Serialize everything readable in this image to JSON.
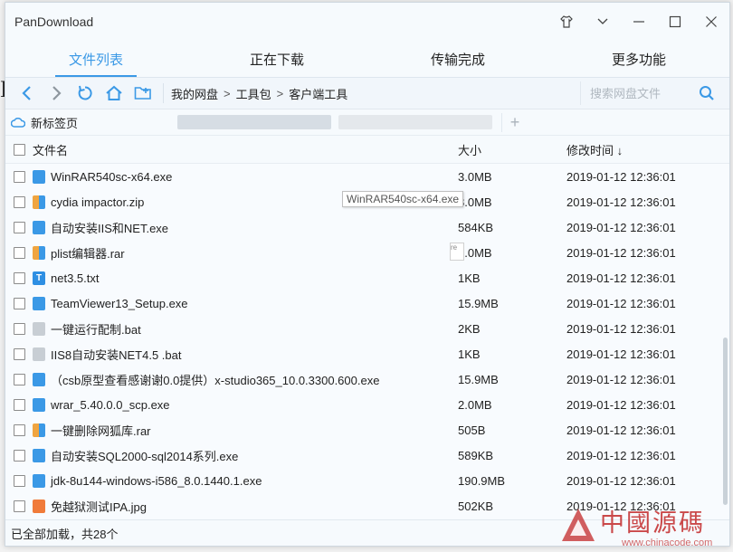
{
  "background_fragment": "I",
  "window": {
    "title": "PanDownload",
    "controls": [
      "shirt-icon",
      "chevron-down-icon",
      "minimize-icon",
      "maximize-icon",
      "close-icon"
    ]
  },
  "tabs": [
    {
      "label": "文件列表",
      "active": true
    },
    {
      "label": "正在下载",
      "active": false
    },
    {
      "label": "传输完成",
      "active": false
    },
    {
      "label": "更多功能",
      "active": false
    }
  ],
  "breadcrumb": [
    "我的网盘",
    "工具包",
    "客户端工具"
  ],
  "breadcrumb_sep": ">",
  "search": {
    "placeholder": "搜索网盘文件"
  },
  "browser_tab": {
    "label": "新标签页"
  },
  "columns": {
    "name": "文件名",
    "size": "大小",
    "date": "修改时间 ↓"
  },
  "files": [
    {
      "name": "WinRAR540sc-x64.exe",
      "size": "3.0MB",
      "date": "2019-01-12 12:36:01",
      "type": "exe"
    },
    {
      "name": "cydia impactor.zip",
      "size": "8.0MB",
      "date": "2019-01-12 12:36:01",
      "type": "zip"
    },
    {
      "name": "自动安装IIS和NET.exe",
      "size": "584KB",
      "date": "2019-01-12 12:36:01",
      "type": "exe"
    },
    {
      "name": "plist编辑器.rar",
      "size": "8.0MB",
      "date": "2019-01-12 12:36:01",
      "type": "zip"
    },
    {
      "name": "net3.5.txt",
      "size": "1KB",
      "date": "2019-01-12 12:36:01",
      "type": "txt"
    },
    {
      "name": "TeamViewer13_Setup.exe",
      "size": "15.9MB",
      "date": "2019-01-12 12:36:01",
      "type": "exe"
    },
    {
      "name": "一键运行配制.bat",
      "size": "2KB",
      "date": "2019-01-12 12:36:01",
      "type": "bat"
    },
    {
      "name": "IIS8自动安装NET4.5 .bat",
      "size": "1KB",
      "date": "2019-01-12 12:36:01",
      "type": "bat"
    },
    {
      "name": "（csb原型查看感谢谢0.0提供）x-studio365_10.0.3300.600.exe",
      "size": "15.9MB",
      "date": "2019-01-12 12:36:01",
      "type": "exe"
    },
    {
      "name": "wrar_5.40.0.0_scp.exe",
      "size": "2.0MB",
      "date": "2019-01-12 12:36:01",
      "type": "exe"
    },
    {
      "name": "一键删除网狐库.rar",
      "size": "505B",
      "date": "2019-01-12 12:36:01",
      "type": "zip"
    },
    {
      "name": "自动安装SQL2000-sql2014系列.exe",
      "size": "589KB",
      "date": "2019-01-12 12:36:01",
      "type": "exe"
    },
    {
      "name": "jdk-8u144-windows-i586_8.0.1440.1.exe",
      "size": "190.9MB",
      "date": "2019-01-12 12:36:01",
      "type": "exe"
    },
    {
      "name": "免越狱测试IPA.jpg",
      "size": "502KB",
      "date": "2019-01-12 12:36:01",
      "type": "img"
    }
  ],
  "tooltip": "WinRAR540sc-x64.exe",
  "tooltip2": "re",
  "status": "已全部加载，共28个",
  "watermark": {
    "title": "中國源碼",
    "url": "www.chinacode.com"
  },
  "accent_color": "#3b99e6"
}
